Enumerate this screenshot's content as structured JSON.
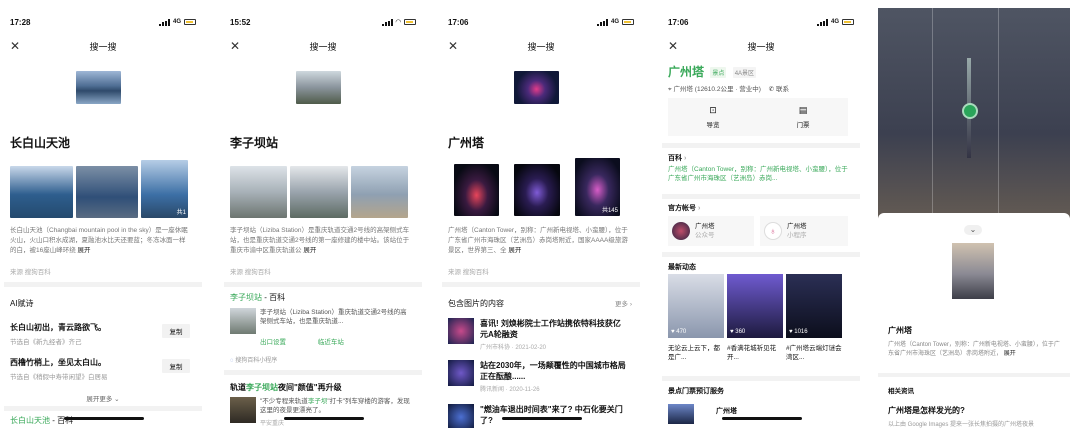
{
  "screens": [
    {
      "time": "17:28",
      "signal": "4G",
      "nav_title": "搜一搜",
      "title": "长白山天池",
      "image_badge": "共1",
      "desc": "长白山天池（Changbai mountain pool in the sky）是一座休眠火山，火山口积水成湖，夏融池水比天还要蓝；冬冻冰面一样的白，被16座山峰环绕",
      "expand": "展开",
      "source": "来源 搜狗百科",
      "section_title": "AI赋诗",
      "poems": [
        {
          "line": "长白山初出，青云路欲飞。",
          "source": "节选自《新九经者》齐己",
          "action": "复制"
        },
        {
          "line": "西橹竹梢上，坐见太白山。",
          "source": "节选自《稍假中寿带闲望》白居易",
          "action": "复制"
        }
      ],
      "more": "展开更多",
      "bottom_a": "长白山天池",
      "bottom_b": " - 百科"
    },
    {
      "time": "15:52",
      "signal": "",
      "nav_title": "搜一搜",
      "title": "李子坝站",
      "desc": "李子坝站（Liziba Station）是重庆轨道交通2号线的高架侧式车站，也是重庆轨道交通2号线的第一座修建的楼中站。该站位于重庆市渝中区重庆轨道公",
      "expand": "展开",
      "source": "来源 搜狗百科",
      "wiki_title_a": "李子坝站",
      "wiki_title_b": " - 百科",
      "wiki_desc": "李子坝站（Liziba Station）重庆轨道交通2号线的高架侧式车站，也是重庆轨道...",
      "link_a": "出口设置",
      "link_b": "临近车站",
      "mini": "搜狗百科小程序",
      "article_title_a": "轨道",
      "article_title_b": "李子坝站",
      "article_title_c": "夜间\"颜值\"再升级",
      "article_desc_a": "\"不少专程来轨道",
      "article_desc_b": "李子坝",
      "article_desc_c": "\"打卡\"列车穿楼的游客，发现这里的夜景更漂亮了。",
      "article_meta": "平安重庆"
    },
    {
      "time": "17:06",
      "signal": "4G",
      "nav_title": "搜一搜",
      "title": "广州塔",
      "image_badge": "共145",
      "desc": "广州塔（Canton Tower，别称：广州新电视塔、小蛮腰），位于广东省广州市海珠区（艺洲岛）赤岗塔附近，国家AAAA级旅游景区，世界第三、全",
      "expand": "展开",
      "source": "来源 搜狗百科",
      "section_title": "包含图片的内容",
      "more": "更多",
      "news": [
        {
          "title": "喜讯! 刘焕彬院士工作站携依特科技获亿元A轮融资",
          "meta": "广州市科协 · 2021-02-20"
        },
        {
          "title": "站在2030年，一场颠覆性的中国城市格局正在酝酿......",
          "meta": "腾讯新闻 · 2020-11-26"
        },
        {
          "title": "\"燃油车退出时间表\"来了? 中石化要关门了?",
          "meta": ""
        }
      ]
    },
    {
      "time": "17:06",
      "signal": "4G",
      "nav_title": "搜一搜",
      "title": "广州塔",
      "tag_a": "景点",
      "tag_b": "4A景区",
      "location": "广州塔 (12610.2公里 · 营业中)",
      "contact": "联系",
      "btn_guide": "导览",
      "btn_ticket": "门票",
      "wiki_label": "百科",
      "wiki_desc": "广州塔（Canton Tower，别称：广州新电视塔、小蛮腰），位于广东省广州市海珠区（艺洲岛）赤岗...",
      "official_label": "官方帐号",
      "acc1_name": "广州塔",
      "acc1_type": "公众号",
      "acc2_name": "广州塔",
      "acc2_type": "小程序",
      "trends_label": "最新动态",
      "trends": [
        {
          "count": "470",
          "caption": "无论云上云下，都是广..."
        },
        {
          "count": "360",
          "caption": "#香满花城祈见花开..."
        },
        {
          "count": "1016",
          "caption": "#广州塔云端灯谜会 湾区..."
        }
      ],
      "ticket_label": "景点门票预订服务",
      "ticket_item": "广州塔"
    },
    {
      "title": "广州塔",
      "desc": "广州塔（Canton Tower，别称：广州新电视塔、小蛮腰），位于广东省广州市海珠区（艺洲岛）赤岗塔附近，",
      "expand": "展开",
      "section_title": "相关资讯",
      "news_title": "广州塔是怎样发光的?",
      "news_desc": "以上由 Google Images 提来一张长焦拍摄的广州塔夜景"
    }
  ]
}
